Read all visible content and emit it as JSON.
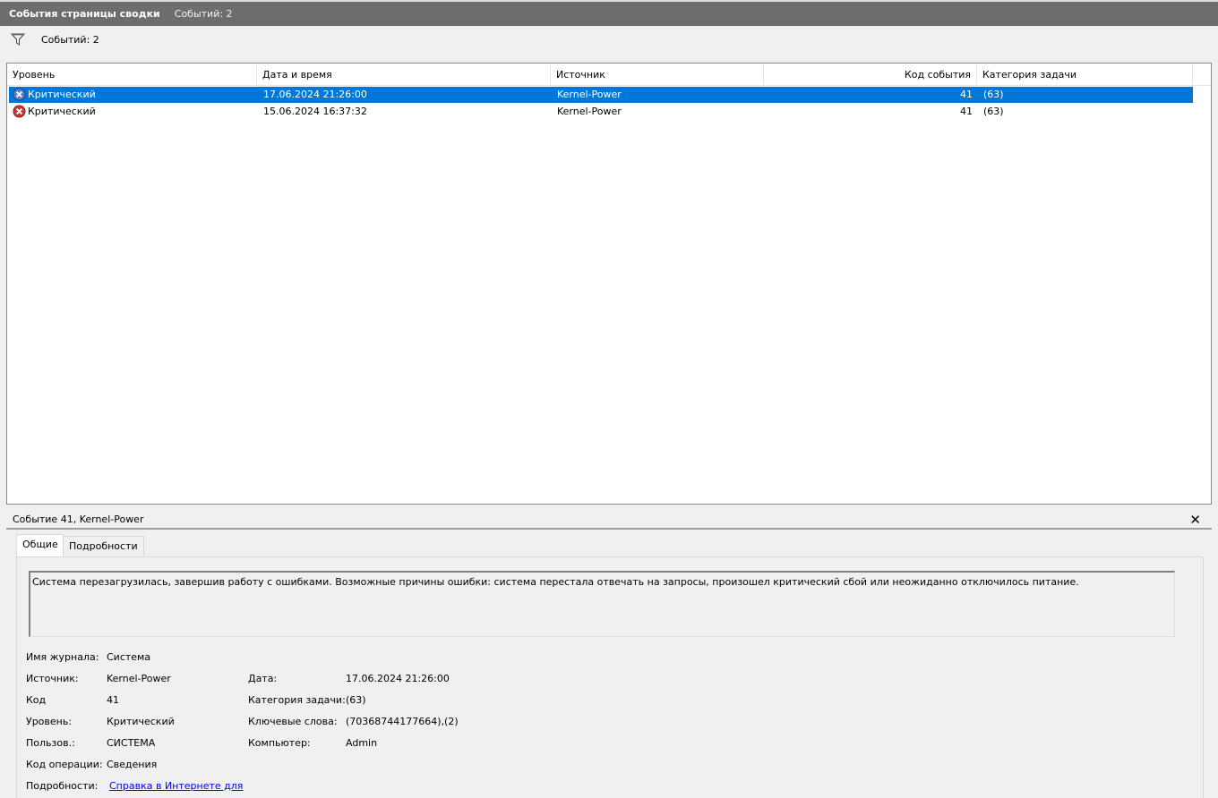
{
  "window": {
    "title": "События страницы сводки",
    "count_label": "Событий: 2"
  },
  "filter": {
    "count_label": "Событий: 2"
  },
  "table": {
    "columns": [
      "Уровень",
      "Дата и время",
      "Источник",
      "Код события",
      "Категория задачи"
    ],
    "rows": [
      {
        "level": "Критический",
        "datetime": "17.06.2024 21:26:00",
        "source": "Kernel-Power",
        "code": "41",
        "category": "(63)",
        "selected": true
      },
      {
        "level": "Критический",
        "datetime": "15.06.2024 16:37:32",
        "source": "Kernel-Power",
        "code": "41",
        "category": "(63)",
        "selected": false
      }
    ]
  },
  "detail": {
    "header": "Событие 41, Kernel-Power",
    "tabs": [
      "Общие",
      "Подробности"
    ],
    "description": "Система перезагрузилась, завершив работу с ошибками. Возможные причины ошибки: система перестала отвечать на запросы, произошел критический сбой или неожиданно отключилось питание.",
    "fields_left": [
      {
        "label": "Имя журнала:",
        "value": "Система"
      },
      {
        "label": "Источник:",
        "value": "Kernel-Power"
      },
      {
        "label": "Код",
        "value": "41"
      },
      {
        "label": "Уровень:",
        "value": "Критический"
      },
      {
        "label": "Пользов.:",
        "value": "СИСТЕМА"
      },
      {
        "label": "Код операции:",
        "value": "Сведения"
      },
      {
        "label": "Подробности:",
        "value": "Справка в Интернете для"
      }
    ],
    "fields_right": [
      {
        "label": "Дата:",
        "value": "17.06.2024 21:26:00"
      },
      {
        "label": "Категория задачи:",
        "value": "(63)"
      },
      {
        "label": "Ключевые слова:",
        "value": "(70368744177664),(2)"
      },
      {
        "label": "Компьютер:",
        "value": "Admin"
      }
    ]
  },
  "colors": {
    "selection": "#0078d7",
    "critical_icon": "#d13438",
    "title_bar": "#6d6d6d"
  },
  "icons": {
    "filter": "filter-icon",
    "critical": "critical-error-icon",
    "close": "close-icon"
  }
}
